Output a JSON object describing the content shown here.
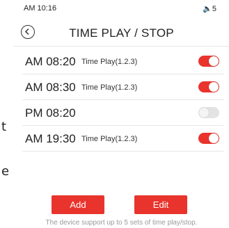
{
  "status_bar": {
    "time": "AM 10:16",
    "volume": "🔈5"
  },
  "header": {
    "title": "TIME PLAY / STOP"
  },
  "schedules": [
    {
      "time": "AM 08:20",
      "mode": "Time Play(1.2.3)",
      "enabled": true
    },
    {
      "time": "AM 08:30",
      "mode": "Time Play(1.2.3)",
      "enabled": true
    },
    {
      "time": "PM 08:20",
      "mode": "",
      "enabled": false
    },
    {
      "time": "AM 19:30",
      "mode": "Time Play(1.2.3)",
      "enabled": true
    }
  ],
  "buttons": {
    "add_label": "Add",
    "edit_label": "Edit"
  },
  "footer_note": "The device support up to 5 sets of time play/stop.",
  "colors": {
    "accent": "#e8342d",
    "toggle_off": "#e3e3e3",
    "divider": "#e6e6e6"
  },
  "background_fragments": [
    "t",
    "e"
  ]
}
